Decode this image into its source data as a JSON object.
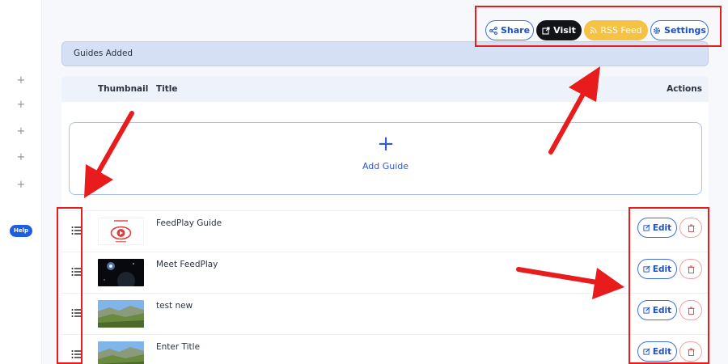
{
  "sidebar": {
    "plus_count": 5,
    "help_label": "Help"
  },
  "toolbar": {
    "share_label": "Share",
    "visit_label": "Visit",
    "rss_label": "RSS Feed",
    "settings_label": "Settings"
  },
  "section_title": "Guides Added",
  "table": {
    "columns": {
      "thumbnail": "Thumbnail",
      "title": "Title",
      "actions": "Actions"
    },
    "add_label": "Add Guide",
    "rows": [
      {
        "title": "FeedPlay Guide",
        "thumb": "feedplay-logo",
        "edit_label": "Edit"
      },
      {
        "title": "Meet FeedPlay",
        "thumb": "dark-space",
        "edit_label": "Edit"
      },
      {
        "title": "test new",
        "thumb": "landscape",
        "edit_label": "Edit"
      },
      {
        "title": "Enter Title",
        "thumb": "landscape",
        "edit_label": "Edit"
      }
    ]
  },
  "colors": {
    "primary": "#1d4fc4",
    "rss": "#f5c243",
    "visit": "#121417",
    "annotation": "#e81c1c",
    "delete": "#e05555"
  }
}
